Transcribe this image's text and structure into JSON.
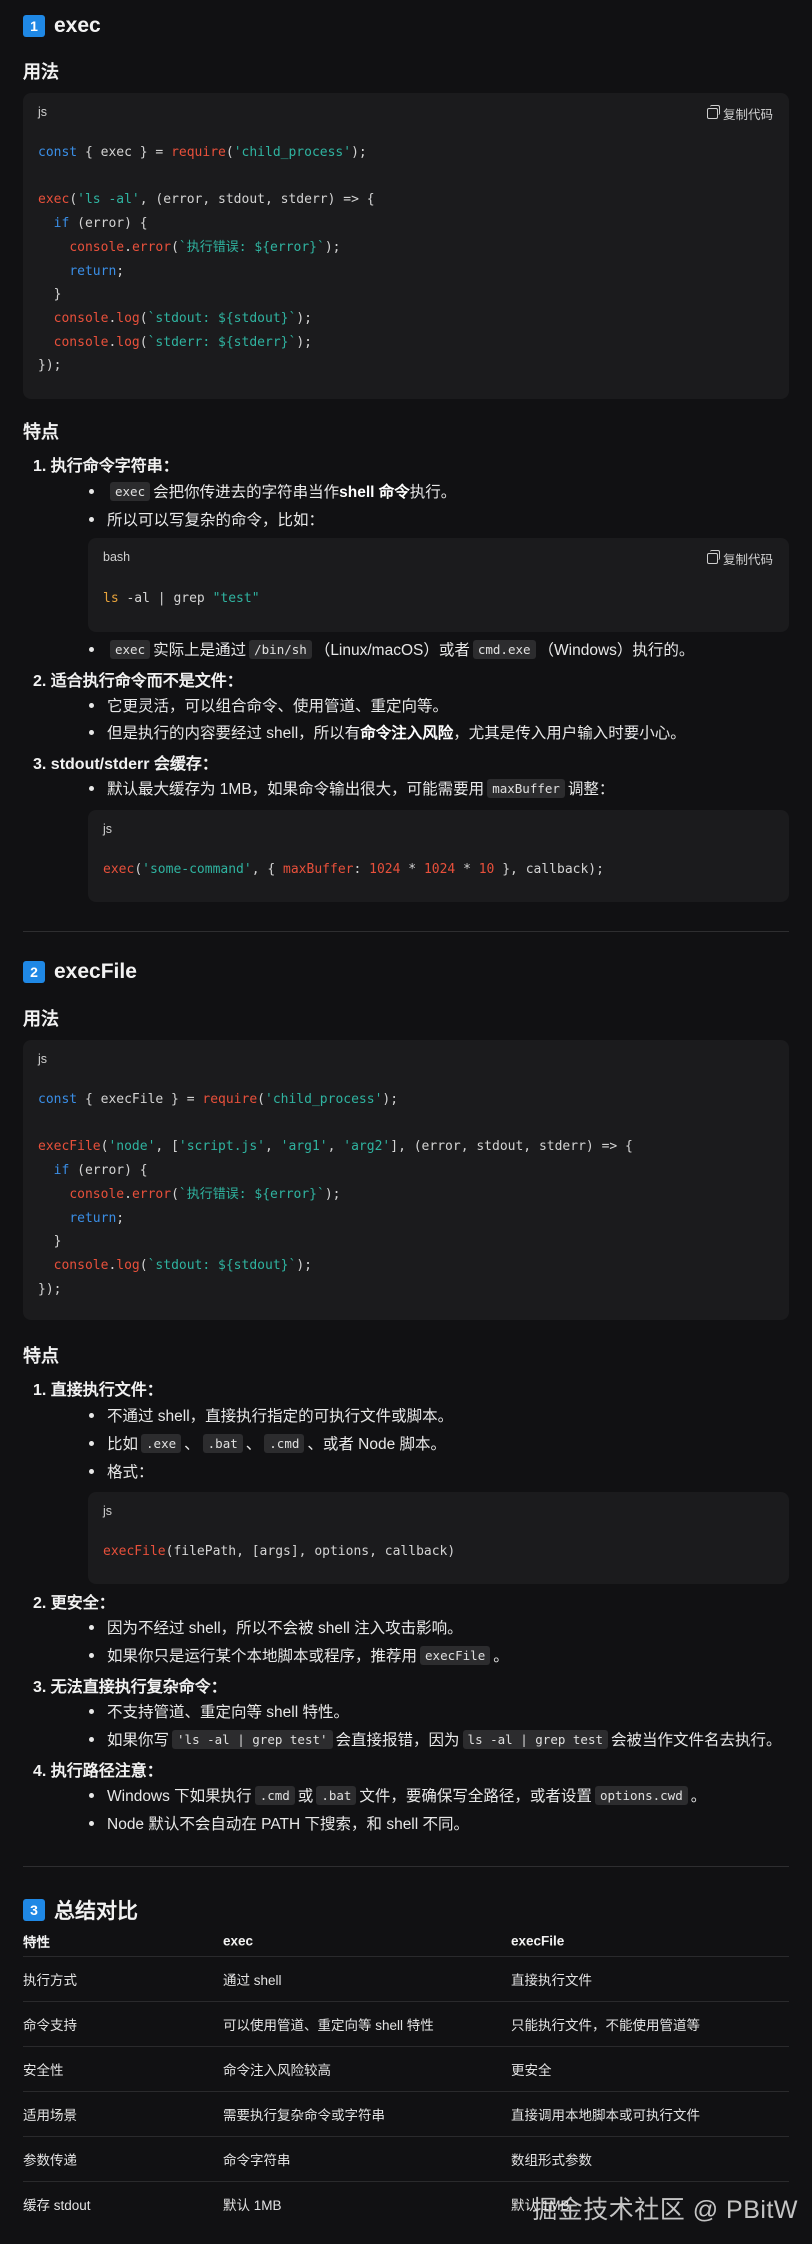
{
  "s1": {
    "num": "1",
    "title": "exec",
    "usage": "用法",
    "code": {
      "lang": "js",
      "copy": "复制代码"
    },
    "features": "特点",
    "f1": {
      "title": "1.  执行命令字符串：",
      "b1a": "exec",
      "b1b": " 会把你传进去的字符串当作 ",
      "b1c": "shell 命令",
      "b1d": " 执行。",
      "b2": "所以可以写复杂的命令，比如：",
      "bash_lang": "bash",
      "bash_copy": "复制代码",
      "b3a": "exec",
      "b3b": " 实际上是通过 ",
      "b3c": "/bin/sh",
      "b3d": "（Linux/macOS）或者 ",
      "b3e": "cmd.exe",
      "b3f": "（Windows）执行的。"
    },
    "f2": {
      "title": "2.  适合执行命令而不是文件：",
      "b1": "它更灵活，可以组合命令、使用管道、重定向等。",
      "b2a": "但是执行的内容要经过 shell，所以有 ",
      "b2b": "命令注入风险",
      "b2c": "，尤其是传入用户输入时要小心。"
    },
    "f3": {
      "title": "3.  stdout/stderr 会缓存：",
      "b1a": "默认最大缓存为 1MB，如果命令输出很大，可能需要用 ",
      "b1b": "maxBuffer",
      "b1c": " 调整：",
      "code_lang": "js"
    }
  },
  "s2": {
    "num": "2",
    "title": "execFile",
    "usage": "用法",
    "code_lang": "js",
    "features": "特点",
    "f1": {
      "title": "1.  直接执行文件：",
      "b1": "不通过 shell，直接执行指定的可执行文件或脚本。",
      "b2a": "比如 ",
      "b2b": ".exe",
      "b2c": "、",
      "b2d": ".bat",
      "b2e": "、",
      "b2f": ".cmd",
      "b2g": "、或者 Node 脚本。",
      "b3": "格式：",
      "code_lang": "js"
    },
    "f2": {
      "title": "2.  更安全：",
      "b1": "因为不经过 shell，所以不会被 shell 注入攻击影响。",
      "b2a": "如果你只是运行某个本地脚本或程序，推荐用 ",
      "b2b": "execFile",
      "b2c": "。"
    },
    "f3": {
      "title": "3.  无法直接执行复杂命令：",
      "b1": "不支持管道、重定向等 shell 特性。",
      "b2a": "如果你写 ",
      "b2b": "'ls -al | grep test'",
      "b2c": " 会直接报错，因为 ",
      "b2d": "ls -al | grep test",
      "b2e": " 会被当作文件名去执行。"
    },
    "f4": {
      "title": "4.  执行路径注意：",
      "b1a": "Windows 下如果执行 ",
      "b1b": ".cmd",
      "b1c": " 或 ",
      "b1d": ".bat",
      "b1e": " 文件，要确保写全路径，或者设置 ",
      "b1f": "options.cwd",
      "b1g": "。",
      "b2": "Node 默认不会自动在 PATH 下搜索，和 shell 不同。"
    }
  },
  "s3": {
    "num": "3",
    "title": "总结对比",
    "headers": [
      "特性",
      "exec",
      "execFile"
    ],
    "rows": [
      [
        "执行方式",
        "通过 shell",
        "直接执行文件"
      ],
      [
        "命令支持",
        "可以使用管道、重定向等 shell 特性",
        "只能执行文件，不能使用管道等"
      ],
      [
        "安全性",
        "命令注入风险较高",
        "更安全"
      ],
      [
        "适用场景",
        "需要执行复杂命令或字符串",
        "直接调用本地脚本或可执行文件"
      ],
      [
        "参数传递",
        "命令字符串",
        "数组形式参数"
      ],
      [
        "缓存 stdout",
        "默认 1MB",
        "默认 1MB"
      ]
    ]
  },
  "watermark": "掘金技术社区 @ PBitW",
  "colors": {
    "accent": "#1f88e5",
    "keyword": "#3a8ee6",
    "function": "#e8503b",
    "string": "#2fb3a0",
    "background": "#111113",
    "code_bg": "#1b1b1d"
  }
}
